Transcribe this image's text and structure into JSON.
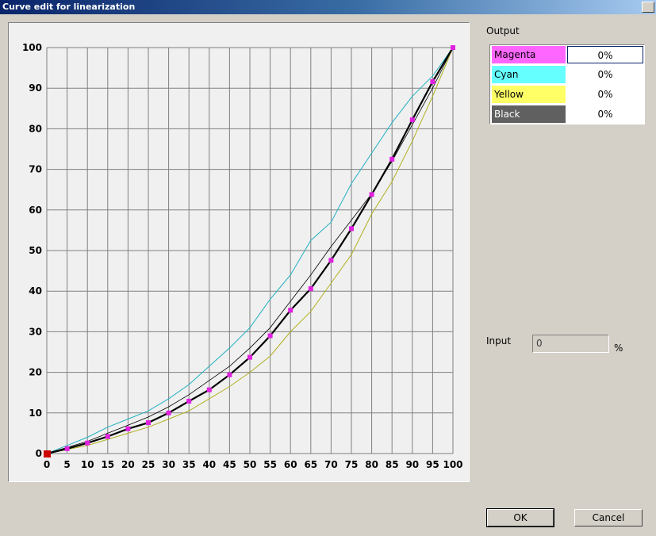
{
  "window": {
    "title": "Curve edit for linearization"
  },
  "output": {
    "label": "Output",
    "rows": [
      {
        "name": "Magenta",
        "value": "0%",
        "color": "#ff66ff",
        "text_color": "#000000"
      },
      {
        "name": "Cyan",
        "value": "0%",
        "color": "#66ffff",
        "text_color": "#000000"
      },
      {
        "name": "Yellow",
        "value": "0%",
        "color": "#ffff66",
        "text_color": "#000000"
      },
      {
        "name": "Black",
        "value": "0%",
        "color": "#606060",
        "text_color": "#ffffff"
      }
    ]
  },
  "input": {
    "label": "Input",
    "value": "0",
    "unit": "%"
  },
  "buttons": {
    "ok": "OK",
    "cancel": "Cancel"
  },
  "chart_data": {
    "type": "line",
    "x_ticks": [
      0,
      5,
      10,
      15,
      20,
      25,
      30,
      35,
      40,
      45,
      50,
      55,
      60,
      65,
      70,
      75,
      80,
      85,
      90,
      95,
      100
    ],
    "y_ticks": [
      0,
      10,
      20,
      30,
      40,
      50,
      60,
      70,
      80,
      90,
      100
    ],
    "xlim": [
      0,
      100
    ],
    "ylim": [
      0,
      100
    ],
    "grid": true,
    "colors": {
      "magenta_points": "#e020e0",
      "selected_point": "#cc0000",
      "cyan": "#20b0c0",
      "yellow": "#b0b020",
      "reference": "#000000",
      "black_curve": "#000000"
    },
    "series": [
      {
        "key": "cyan",
        "x": [
          0,
          5,
          10,
          15,
          20,
          25,
          30,
          35,
          40,
          45,
          50,
          55,
          60,
          65,
          70,
          75,
          80,
          85,
          90,
          95,
          100
        ],
        "y": [
          0,
          2,
          4,
          6.5,
          8.5,
          10.5,
          13.5,
          17,
          21.5,
          26,
          31,
          38,
          44,
          52.5,
          57,
          66.5,
          74,
          81.5,
          88,
          93,
          100
        ]
      },
      {
        "key": "yellow",
        "x": [
          0,
          5,
          10,
          15,
          20,
          25,
          30,
          35,
          40,
          45,
          50,
          55,
          60,
          65,
          70,
          75,
          80,
          85,
          90,
          95,
          100
        ],
        "y": [
          0,
          1,
          2,
          3.5,
          5,
          6.5,
          8.5,
          10.5,
          13.5,
          16.5,
          20,
          24,
          30,
          35,
          42,
          49,
          59,
          67,
          77,
          88,
          100
        ]
      },
      {
        "key": "reference",
        "x": [
          0,
          5,
          10,
          15,
          20,
          25,
          30,
          35,
          40,
          45,
          50,
          55,
          60,
          65,
          70,
          75,
          80,
          85,
          90,
          95,
          100
        ],
        "y": [
          0,
          1.5,
          3,
          5,
          7,
          9,
          11.5,
          14.5,
          18,
          21.5,
          26,
          31,
          37.5,
          44,
          51,
          57.5,
          64,
          72,
          81,
          90,
          100
        ]
      },
      {
        "key": "black_curve",
        "x": [
          0,
          5,
          10,
          15,
          20,
          25,
          30,
          35,
          40,
          45,
          50,
          55,
          60,
          65,
          70,
          75,
          80,
          85,
          90,
          95,
          100
        ],
        "y": [
          0,
          1.2,
          2.6,
          4.2,
          6.1,
          7.6,
          10,
          12.9,
          15.7,
          19.4,
          23.7,
          29,
          35.3,
          40.6,
          47.6,
          55.4,
          63.8,
          72.5,
          82.2,
          91.6,
          100
        ]
      }
    ],
    "points": {
      "x": [
        5,
        10,
        15,
        20,
        25,
        30,
        35,
        40,
        45,
        50,
        55,
        60,
        65,
        70,
        75,
        80,
        85,
        90,
        95,
        100
      ],
      "y": [
        1.2,
        2.6,
        4.2,
        6.1,
        7.6,
        10,
        12.9,
        15.7,
        19.4,
        23.7,
        29,
        35.3,
        40.6,
        47.6,
        55.4,
        63.8,
        72.5,
        82.2,
        91.6,
        100
      ]
    },
    "selected_point": {
      "x": 0,
      "y": 0
    }
  }
}
